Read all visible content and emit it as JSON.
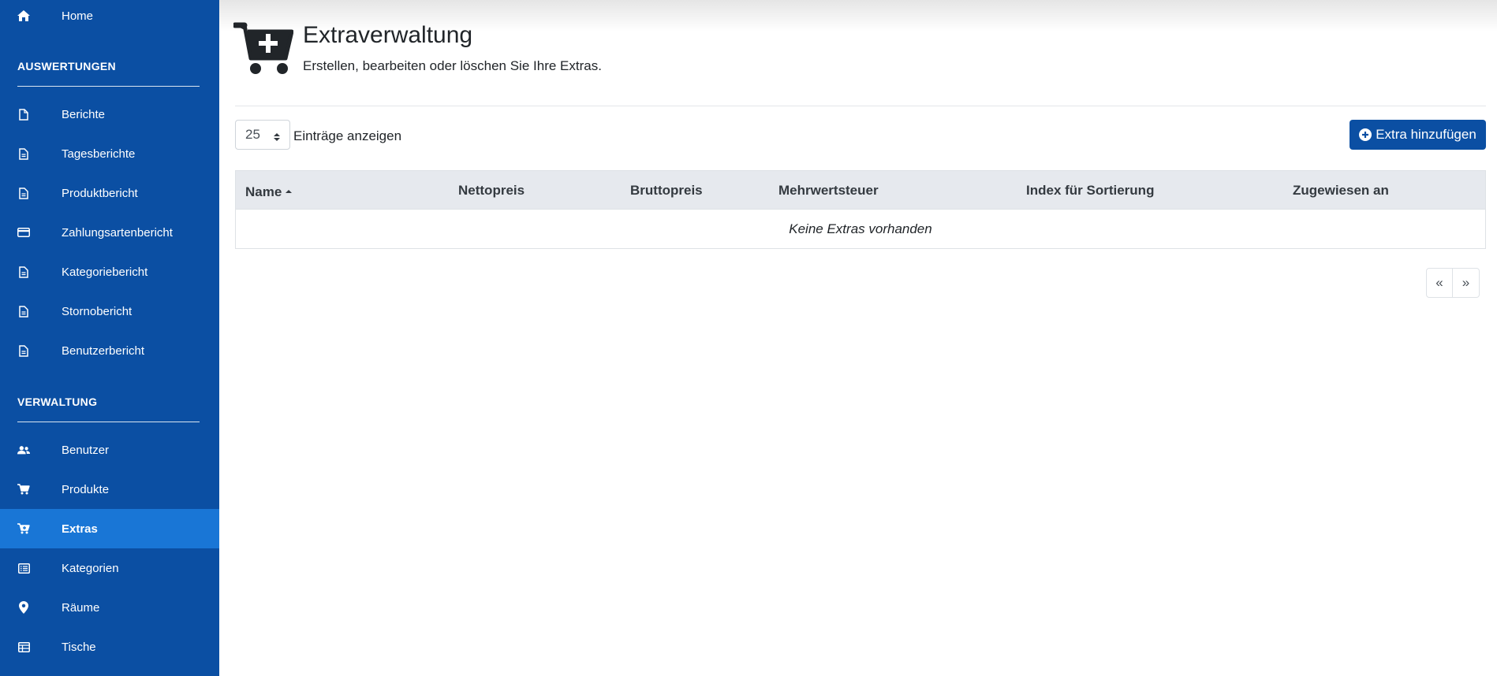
{
  "sidebar": {
    "home": "Home",
    "sections": [
      {
        "title": "AUSWERTUNGEN",
        "items": [
          {
            "label": "Berichte",
            "icon": "file-icon"
          },
          {
            "label": "Tagesberichte",
            "icon": "file-lines-icon"
          },
          {
            "label": "Produktbericht",
            "icon": "file-lines-icon"
          },
          {
            "label": "Zahlungsartenbericht",
            "icon": "credit-card-icon"
          },
          {
            "label": "Kategoriebericht",
            "icon": "file-lines-icon"
          },
          {
            "label": "Stornobericht",
            "icon": "file-lines-icon"
          },
          {
            "label": "Benutzerbericht",
            "icon": "file-lines-icon"
          }
        ]
      },
      {
        "title": "VERWALTUNG",
        "items": [
          {
            "label": "Benutzer",
            "icon": "users-icon"
          },
          {
            "label": "Produkte",
            "icon": "cart-icon"
          },
          {
            "label": "Extras",
            "icon": "cart-plus-icon",
            "active": true
          },
          {
            "label": "Kategorien",
            "icon": "list-icon"
          },
          {
            "label": "Räume",
            "icon": "map-marker-icon"
          },
          {
            "label": "Tische",
            "icon": "table-icon"
          }
        ]
      }
    ]
  },
  "header": {
    "title": "Extraverwaltung",
    "subtitle": "Erstellen, bearbeiten oder löschen Sie Ihre Extras.",
    "icon": "cart-plus-icon"
  },
  "controls": {
    "page_size": "25",
    "entries_label": "Einträge anzeigen",
    "add_button": "Extra hinzufügen"
  },
  "table": {
    "columns": [
      "Name",
      "Nettopreis",
      "Bruttopreis",
      "Mehrwertsteuer",
      "Index für Sortierung",
      "Zugewiesen an"
    ],
    "empty_message": "Keine Extras vorhanden"
  },
  "pagination": {
    "prev": "«",
    "next": "»"
  },
  "colors": {
    "sidebar_bg": "#0b4fa3",
    "sidebar_active": "#1976d6",
    "primary_button": "#0b4fa3",
    "table_header_bg": "#e6e9ee"
  }
}
